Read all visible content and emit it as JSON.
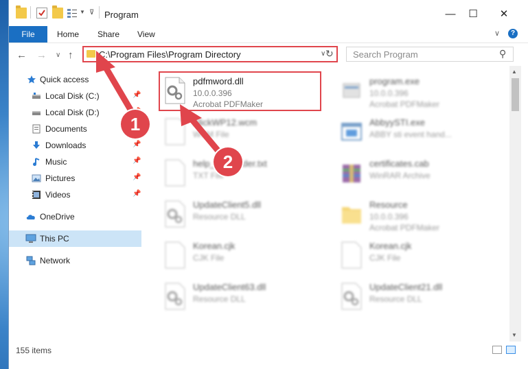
{
  "window": {
    "title": "Program",
    "controls": {
      "minimize": "—",
      "maximize": "☐",
      "close": "✕"
    }
  },
  "ribbon": {
    "tabs": [
      "File",
      "Home",
      "Share",
      "View"
    ],
    "help": "?",
    "expand": "∨"
  },
  "navigation": {
    "back": "←",
    "forward": "→",
    "recent": "∨",
    "up": "↑",
    "address": "C:\\Program Files\\Program Directory",
    "dropdown": "∨",
    "refresh": "↻",
    "search_placeholder": "Search Program",
    "search_icon": "⚲"
  },
  "sidebar": {
    "items": [
      {
        "label": "Quick access",
        "icon": "star-icon",
        "pinned": false
      },
      {
        "label": "Local Disk (C:)",
        "icon": "drive-icon",
        "pinned": true
      },
      {
        "label": "Local Disk (D:)",
        "icon": "drive-icon",
        "pinned": true
      },
      {
        "label": "Documents",
        "icon": "documents-icon",
        "pinned": true
      },
      {
        "label": "Downloads",
        "icon": "download-icon",
        "pinned": true
      },
      {
        "label": "Music",
        "icon": "music-icon",
        "pinned": true
      },
      {
        "label": "Pictures",
        "icon": "pictures-icon",
        "pinned": true
      },
      {
        "label": "Videos",
        "icon": "videos-icon",
        "pinned": true
      },
      {
        "label": "OneDrive",
        "icon": "cloud-icon",
        "pinned": false
      },
      {
        "label": "This PC",
        "icon": "computer-icon",
        "pinned": false,
        "selected": true
      },
      {
        "label": "Network",
        "icon": "network-icon",
        "pinned": false
      }
    ],
    "pin_glyph": "📌"
  },
  "files": [
    {
      "name": "pdfmword.dll",
      "line1": "10.0.0.396",
      "line2": "Acrobat PDFMaker",
      "icon": "dll-gear-icon",
      "highlighted": true
    },
    {
      "name": "program.exe",
      "line1": "10.0.0.396",
      "line2": "Acrobat PDFMaker",
      "icon": "exe-icon"
    },
    {
      "name": "SlickWP12.wcm",
      "line1": "WCM File",
      "line2": "",
      "icon": "blank-file-icon"
    },
    {
      "name": "AbbyySTI.exe",
      "line1": "ABBY sti event hand...",
      "line2": "",
      "icon": "window-app-icon"
    },
    {
      "name": "help_on_reader.txt",
      "line1": "TXT File",
      "line2": "",
      "icon": "blank-file-icon"
    },
    {
      "name": "certificates.cab",
      "line1": "WinRAR Archive",
      "line2": "",
      "icon": "archive-icon"
    },
    {
      "name": "UpdateClient5.dll",
      "line1": "Resource DLL",
      "line2": "",
      "icon": "dll-gear-icon"
    },
    {
      "name": "Resource",
      "line1": "10.0.0.396",
      "line2": "Acrobat PDFMaker",
      "icon": "folder-icon"
    },
    {
      "name": "Korean.cjk",
      "line1": "CJK File",
      "line2": "",
      "icon": "blank-file-icon"
    },
    {
      "name": "Korean.cjk",
      "line1": "CJK File",
      "line2": "",
      "icon": "blank-file-icon"
    },
    {
      "name": "UpdateClient63.dll",
      "line1": "Resource DLL",
      "line2": "",
      "icon": "dll-gear-icon"
    },
    {
      "name": "UpdateClient21.dll",
      "line1": "Resource DLL",
      "line2": "",
      "icon": "dll-gear-icon"
    }
  ],
  "status": {
    "item_count": "155 items"
  },
  "callouts": [
    "1",
    "2"
  ],
  "colors": {
    "accent": "#1a6fc3",
    "highlight": "#e0454c",
    "selected": "#cce4f7"
  }
}
